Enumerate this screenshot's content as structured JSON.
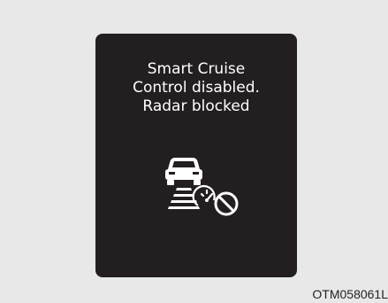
{
  "display": {
    "message_lines": [
      "Smart Cruise",
      "Control disabled.",
      "Radar blocked"
    ],
    "icon": "smart-cruise-radar-blocked-icon"
  },
  "reference_code": "OTM058061L",
  "colors": {
    "background": "#e8e8e8",
    "panel": "#231f20",
    "text": "#ffffff"
  }
}
